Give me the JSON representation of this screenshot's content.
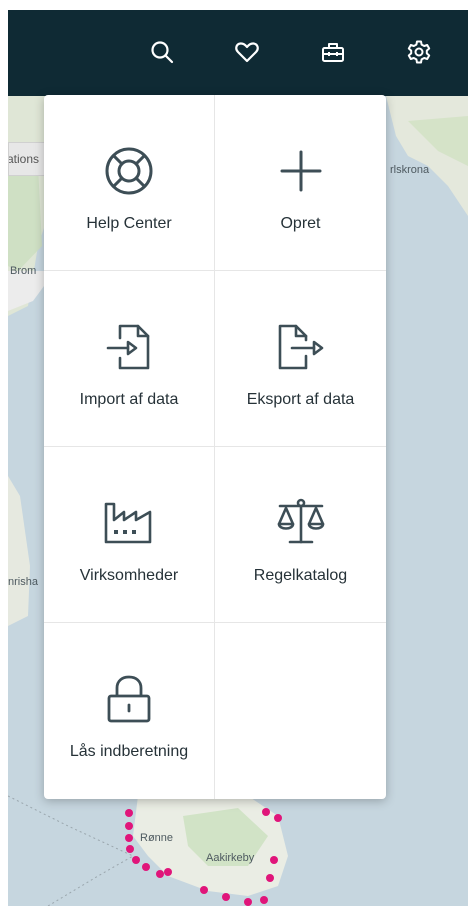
{
  "topbar": {
    "icons": [
      "search-icon",
      "heart-icon",
      "toolbox-icon",
      "gear-icon"
    ]
  },
  "map": {
    "chip_text": "ations",
    "labels": {
      "karlskrona": "rlskrona",
      "bromolla": "Brom",
      "simrishamn": "nrisha",
      "ronne": "Rønne",
      "aakirkeby": "Aakirkeby"
    }
  },
  "menu": {
    "items": [
      {
        "label": "Help Center",
        "icon": "lifebuoy-icon"
      },
      {
        "label": "Opret",
        "icon": "plus-icon"
      },
      {
        "label": "Import af data",
        "icon": "import-file-icon"
      },
      {
        "label": "Eksport af data",
        "icon": "export-file-icon"
      },
      {
        "label": "Virksomheder",
        "icon": "factory-icon"
      },
      {
        "label": "Regelkatalog",
        "icon": "scales-icon"
      },
      {
        "label": "Lås indberetning",
        "icon": "lock-icon"
      }
    ]
  },
  "colors": {
    "topbar": "#0f2a34",
    "icon_dark": "#3d4e56",
    "sea": "#c6d6df",
    "land": "#eef0ea",
    "marker": "#e0157a"
  }
}
